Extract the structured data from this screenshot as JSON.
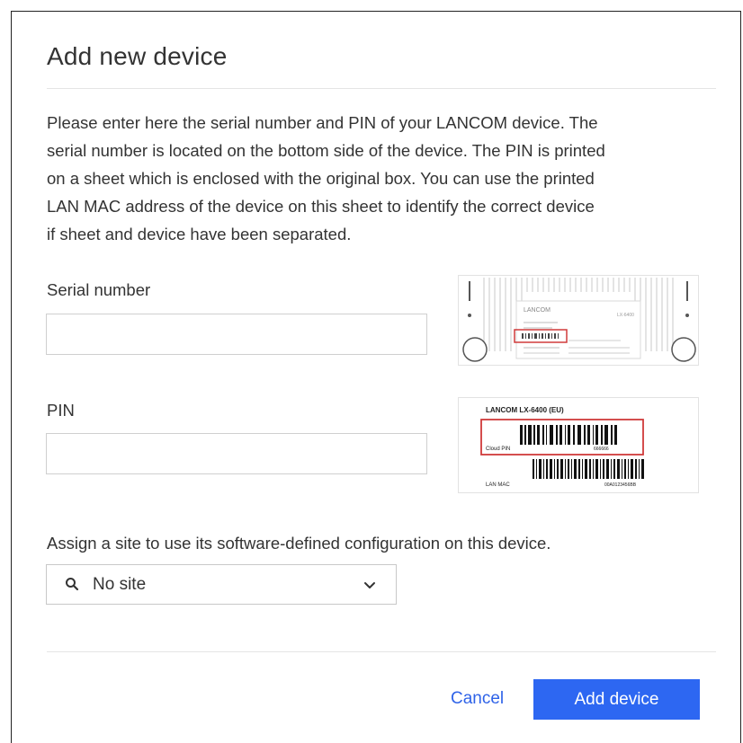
{
  "dialog": {
    "title": "Add new device",
    "description_lines": [
      "Please enter here the serial number and PIN of your LANCOM device. The",
      "serial number is located on the bottom side of the device. The PIN is printed",
      "on a sheet which is enclosed with the original box. You can use the printed",
      "LAN MAC address of the device on this sheet to identify the correct device",
      "if sheet and device have been separated."
    ],
    "serial": {
      "label": "Serial number",
      "value": "",
      "placeholder": ""
    },
    "pin": {
      "label": "PIN",
      "value": "",
      "placeholder": ""
    },
    "device_image": {
      "brand": "LANCOM",
      "model": "LX-6400"
    },
    "pin_sheet": {
      "heading": "LANCOM LX-6400 (EU)",
      "cloud_pin_label": "Cloud PIN",
      "cloud_pin_value": "666666",
      "lan_mac_label": "LAN MAC",
      "lan_mac_value": "00A0123456BB"
    },
    "site": {
      "label": "Assign a site to use its software-defined configuration on this device.",
      "selected": "No site",
      "icon": "search-icon"
    },
    "buttons": {
      "cancel": "Cancel",
      "add": "Add device"
    },
    "colors": {
      "accent": "#2d67f2",
      "highlight": "#d03a3a"
    }
  }
}
